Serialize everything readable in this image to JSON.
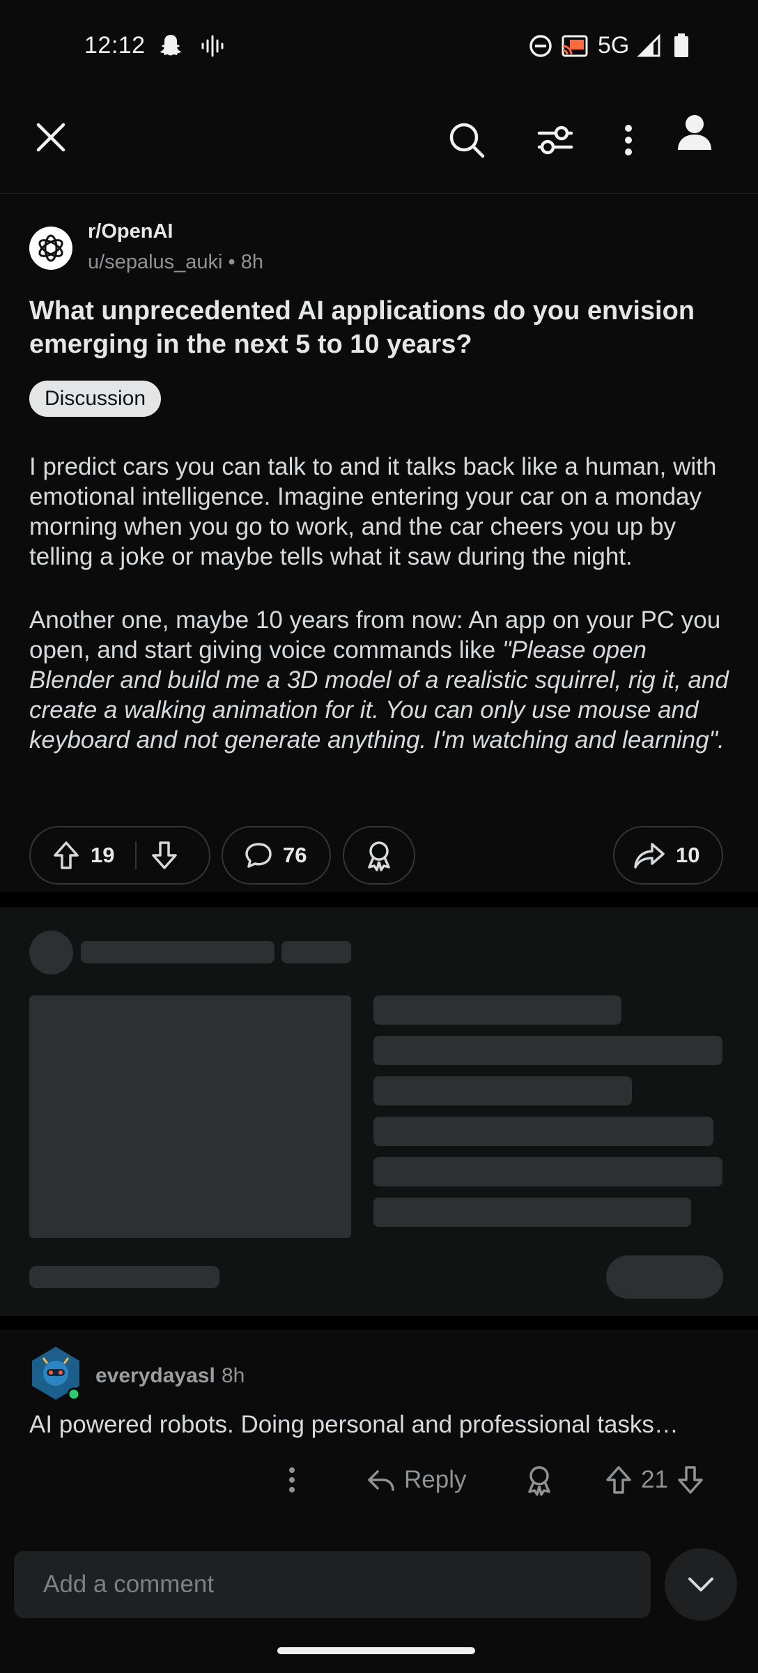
{
  "status_bar": {
    "time": "12:12",
    "network": "5G"
  },
  "top_bar": {
    "close_icon": "close-icon",
    "search_icon": "search-icon",
    "filter_icon": "filter-icon",
    "more_icon": "more-vertical-icon",
    "profile_icon": "profile-icon"
  },
  "post": {
    "subreddit": "r/OpenAI",
    "author": "u/sepalus_auki",
    "age": "8h",
    "title": "What unprecedented AI applications do you envision emerging in the next 5 to 10 years?",
    "flair": "Discussion",
    "body_paragraph_1": "I predict cars you can talk to and it talks back like a human, with emotional intelligence. Imagine entering your car on a monday morning when you go to work, and the car cheers you up by telling a joke or maybe tells what it saw during the night.",
    "body_paragraph_2_plain": "Another one, maybe 10 years from now: An app on your PC you open, and start giving voice commands like ",
    "body_paragraph_2_italic": "\"Please open Blender and build me a 3D model of a realistic squirrel, rig it, and create a walking animation for it. You can only use mouse and keyboard and not generate anything. I'm watching and learning\".",
    "upvotes": "19",
    "comments": "76",
    "shares": "10"
  },
  "comment": {
    "author": "everydayasl",
    "age": "8h",
    "text": "AI powered robots. Doing personal and professional tasks…",
    "reply_label": "Reply",
    "votes": "21"
  },
  "composer": {
    "placeholder": "Add a comment"
  },
  "colors": {
    "background": "#0b0b0b",
    "skeleton": "#2c3032",
    "online": "#2ecc71"
  }
}
